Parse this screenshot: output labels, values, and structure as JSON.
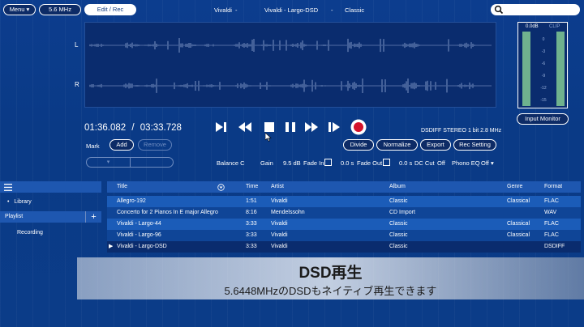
{
  "top_bar": {
    "menu_label": "Menu",
    "menu_chevron": "▾",
    "rate_label": "5.6 MHz",
    "rate_chevron": "▾",
    "editrec_label": "Edit / Rec",
    "now_playing": {
      "artist": "Vivaldi",
      "sep1": "-",
      "track": "Vivaldi - Largo-DSD",
      "sep2": "-",
      "genre": "Classic"
    },
    "search_placeholder": ""
  },
  "waveform": {
    "channel_left": "L",
    "channel_right": "R"
  },
  "meter": {
    "db_label": "0.0dB",
    "clip_label": "CLIP",
    "scale": [
      "0",
      "-3",
      "-6",
      "-9",
      "-12",
      "-15"
    ],
    "input_monitor_label": "Input Monitor"
  },
  "transport": {
    "position": "01:36.082",
    "separator": "/",
    "duration": "03:33.728",
    "format_info": "DSDIFF STEREO 1 bit 2.8 MHz"
  },
  "mark": {
    "label": "Mark",
    "add_label": "Add",
    "remove_label": "Remove",
    "select_chevron": "▾"
  },
  "edit_buttons": {
    "divide": "Divide",
    "normalize": "Normalize",
    "export": "Export",
    "rec_setting": "Rec Setting"
  },
  "params": {
    "balance_label": "Balance C",
    "gain_label": "Gain",
    "gain_value": "9.5 dB",
    "fade_in_label": "Fade In",
    "fade_in_value": "0.0 s",
    "fade_out_label": "Fade Out",
    "fade_out_value": "0.0 s",
    "dc_cut_label": "DC Cut",
    "dc_cut_value": "Off",
    "phono_eq_label": "Phono EQ",
    "phono_eq_value": "Off ▾"
  },
  "sidebar": {
    "library_label": "Library",
    "playlist_label": "Playlist",
    "add_symbol": "+",
    "recording_label": "Recording"
  },
  "table": {
    "headers": {
      "title": "Title",
      "time": "Time",
      "artist": "Artist",
      "album": "Album",
      "genre": "Genre",
      "format": "Format"
    },
    "rows": [
      {
        "title": "Allegro-192",
        "time": "1:51",
        "artist": "Vivaldi",
        "album": "Classic",
        "genre": "Classical",
        "format": "FLAC"
      },
      {
        "title": "Concerto for 2 Pianos In E major Allegro",
        "time": "8:16",
        "artist": "Mendelssohn",
        "album": "CD Import",
        "genre": "",
        "format": "WAV"
      },
      {
        "title": "Vivaldi - Largo-44",
        "time": "3:33",
        "artist": "Vivaldi",
        "album": "Classic",
        "genre": "Classical",
        "format": "FLAC"
      },
      {
        "title": "Vivaldi - Largo-96",
        "time": "3:33",
        "artist": "Vivaldi",
        "album": "Classic",
        "genre": "Classical",
        "format": "FLAC"
      },
      {
        "title": "Vivaldi - Largo-DSD",
        "time": "3:33",
        "artist": "Vivaldi",
        "album": "Classic",
        "genre": "",
        "format": "DSDIFF"
      }
    ],
    "playing_marker": "▶"
  },
  "caption": {
    "title": "DSD再生",
    "subtitle": "5.6448MHzのDSDもネイティブ再生できます"
  },
  "colors": {
    "background": "#0b3c88",
    "waveform_bg": "#0a2c6e",
    "record": "#d3122b",
    "meter_green": "#6fb28e"
  }
}
